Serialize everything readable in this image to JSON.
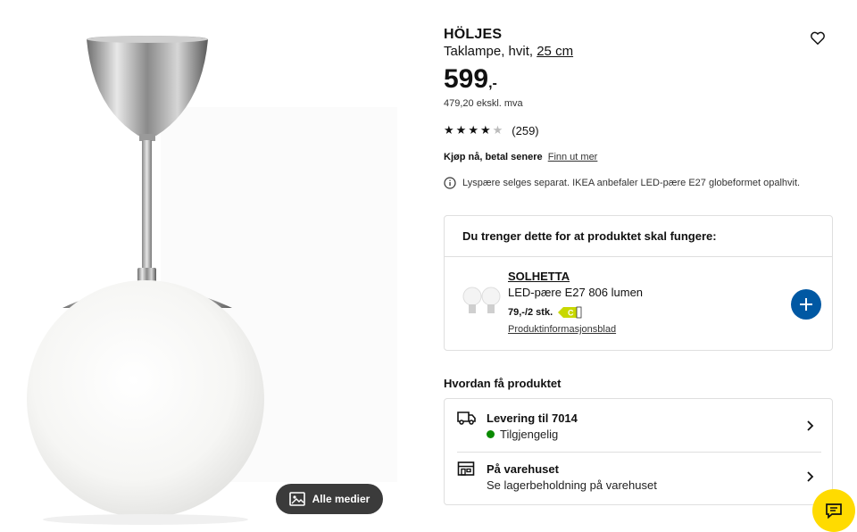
{
  "product": {
    "name": "HÖLJES",
    "desc_prefix": "Taklampe, hvit,",
    "size_link": "25 cm",
    "price_main": "599",
    "price_suffix": ",-",
    "price_ex_vat": "479,20 ekskl. mva",
    "rating": 4.5,
    "rating_count": "(259)",
    "pay_bold": "Kjøp nå, betal senere",
    "pay_link": "Finn ut mer",
    "bulb_note": "Lyspære selges separat. IKEA anbefaler LED-pære E27 globeformet opalhvit."
  },
  "media": {
    "button_label": "Alle medier"
  },
  "accessory_box": {
    "title": "Du trenger dette for at produktet skal fungere:",
    "item_name": "SOLHETTA",
    "item_desc": "LED-pære E27 806 lumen",
    "item_price": "79,-/2 stk.",
    "energy_class": "C",
    "item_link": "Produktinformasjonsblad"
  },
  "delivery": {
    "heading": "Hvordan få produktet",
    "rows": [
      {
        "title": "Levering til 7014",
        "subtitle": "Tilgjengelig"
      },
      {
        "title": "På varehuset",
        "subtitle": "Se lagerbeholdning på varehuset"
      }
    ]
  },
  "colors": {
    "accent": "#0058a3",
    "chat": "#ffdb00",
    "available": "#0a8a00"
  },
  "icons": [
    "heart-icon",
    "info-icon",
    "plus-icon",
    "truck-icon",
    "store-icon",
    "chevron-right-icon",
    "image-gallery-icon",
    "chat-icon"
  ]
}
